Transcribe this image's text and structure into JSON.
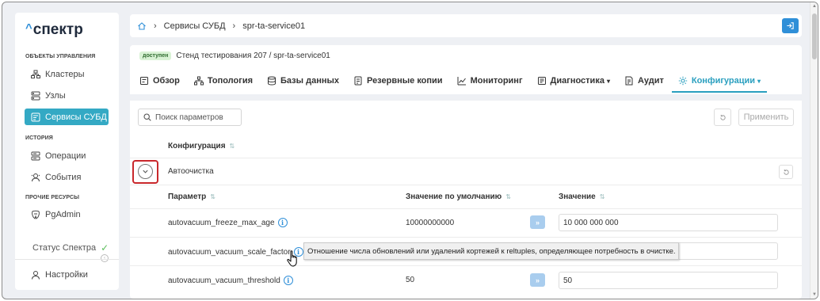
{
  "logo": {
    "text": "спектр",
    "caret": "^"
  },
  "sidebar": {
    "section_management": "ОБЪЕКТЫ УПРАВЛЕНИЯ",
    "clusters": "Кластеры",
    "nodes": "Узлы",
    "dbms_services": "Сервисы СУБД",
    "section_history": "ИСТОРИЯ",
    "operations": "Операции",
    "events": "События",
    "section_other": "ПРОЧИЕ РЕСУРСЫ",
    "pgadmin": "PgAdmin",
    "status": "Статус Спектра",
    "settings": "Настройки",
    "active_color": "#34a9c4"
  },
  "breadcrumb": {
    "level1": "Сервисы СУБД",
    "level2": "spr-ta-service01"
  },
  "header": {
    "badge": "доступен",
    "title": "Стенд тестирования 207 /  spr-ta-service01"
  },
  "tabs": {
    "overview": "Обзор",
    "topology": "Топология",
    "databases": "Базы данных",
    "backups": "Резервные копии",
    "monitoring": "Мониторинг",
    "diagnostics": "Диагностика",
    "audit": "Аудит",
    "config": "Конфигурации"
  },
  "toolbar": {
    "search_placeholder": "Поиск параметров",
    "apply_label": "Применить"
  },
  "table": {
    "group_header": "Конфигурация",
    "group_name": "Автоочистка",
    "col_param": "Параметр",
    "col_default": "Значение по умолчанию",
    "col_value": "Значение",
    "rows": [
      {
        "name": "autovacuum_freeze_max_age",
        "default": "10000000000",
        "value": "10 000 000 000"
      },
      {
        "name": "autovacuum_vacuum_scale_factor",
        "default": "",
        "value": ""
      },
      {
        "name": "autovacuum_vacuum_threshold",
        "default": "50",
        "value": "50"
      }
    ]
  },
  "tooltip": "Отношение числа обновлений или удалений кортежей к reltuples, определяющее потребность в очистке.",
  "accent_color": "#2a9fbf",
  "primary_color": "#2f8fd8",
  "highlight_color": "#c9282c"
}
